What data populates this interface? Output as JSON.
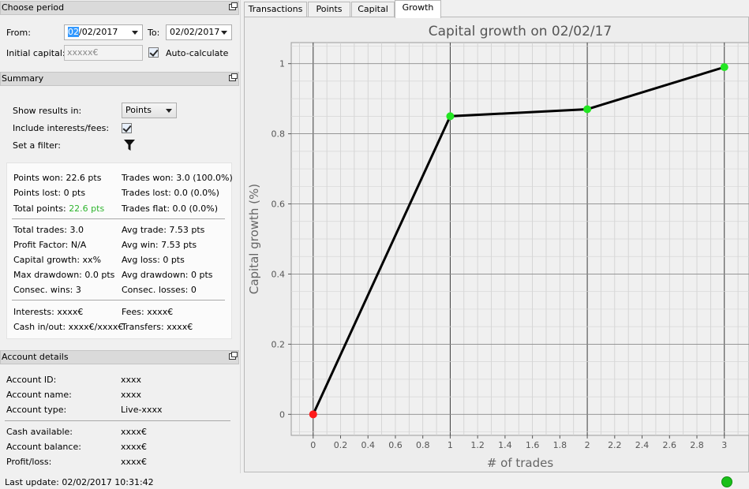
{
  "choose_period": {
    "title": "Choose period",
    "from_label": "From:",
    "from_selected": "02",
    "from_rest": "/02/2017",
    "to_label": "To:",
    "to_value": "02/02/2017",
    "initial_capital_label": "Initial capital:",
    "initial_capital_value": "xxxxx€",
    "auto_calculate_label": "Auto-calculate"
  },
  "summary": {
    "title": "Summary",
    "show_results_label": "Show results in:",
    "show_results_value": "Points",
    "include_interests_label": "Include interests/fees:",
    "filter_label": "Set a filter:",
    "stats": {
      "points_won": "Points won: 22.6 pts",
      "trades_won": "Trades won: 3.0 (100.0%)",
      "points_lost": "Points lost: 0 pts",
      "trades_lost": "Trades lost: 0.0 (0.0%)",
      "total_points_label": "Total points:",
      "total_points_value": "22.6 pts",
      "trades_flat": "Trades flat: 0.0 (0.0%)",
      "total_trades": "Total trades: 3.0",
      "avg_trade": "Avg trade: 7.53 pts",
      "profit_factor": "Profit Factor: N/A",
      "avg_win": "Avg win: 7.53 pts",
      "capital_growth": "Capital growth: xx%",
      "avg_loss": "Avg loss: 0 pts",
      "max_drawdown": "Max drawdown: 0.0 pts",
      "avg_drawdown": "Avg drawdown: 0 pts",
      "consec_wins": "Consec. wins: 3",
      "consec_losses": "Consec. losses: 0",
      "interests": "Interests: xxxx€",
      "fees": "Fees: xxxx€",
      "cash_inout": "Cash in/out: xxxx€/xxxx€",
      "transfers": "Transfers: xxxx€"
    }
  },
  "account_details": {
    "title": "Account details",
    "rows": [
      {
        "label": "Account ID:",
        "value": "xxxx"
      },
      {
        "label": "Account name:",
        "value": "xxxx"
      },
      {
        "label": "Account type:",
        "value": "Live-xxxx"
      },
      {
        "label": "Cash available:",
        "value": "xxxx€"
      },
      {
        "label": "Account balance:",
        "value": "xxxx€"
      },
      {
        "label": "Profit/loss:",
        "value": "xxxx€"
      }
    ]
  },
  "status": {
    "last_update": "Last update: 02/02/2017 10:31:42",
    "connection_color": "#19c019"
  },
  "tabs": [
    {
      "label": "Transactions",
      "active": false
    },
    {
      "label": "Points",
      "active": false
    },
    {
      "label": "Capital",
      "active": false
    },
    {
      "label": "Growth",
      "active": true
    }
  ],
  "chart_data": {
    "type": "line",
    "title": "Capital growth on 02/02/17",
    "xlabel": "# of trades",
    "ylabel": "Capital growth (%)",
    "x": [
      0,
      1,
      2,
      3
    ],
    "y": [
      0,
      0.85,
      0.87,
      0.99
    ],
    "point_colors": [
      "#ff1a1a",
      "#22e622",
      "#22e622",
      "#22e622"
    ],
    "line_color": "#000000",
    "xlim": [
      -0.16,
      3.18
    ],
    "ylim": [
      -0.06,
      1.06
    ],
    "xticks": [
      "0",
      "0.2",
      "0.4",
      "0.6",
      "0.8",
      "1",
      "1.2",
      "1.4",
      "1.6",
      "1.8",
      "2",
      "2.2",
      "2.4",
      "2.6",
      "2.8",
      "3"
    ],
    "yticks": [
      "0",
      "0.2",
      "0.4",
      "0.6",
      "0.8",
      "1"
    ],
    "grid": true
  }
}
